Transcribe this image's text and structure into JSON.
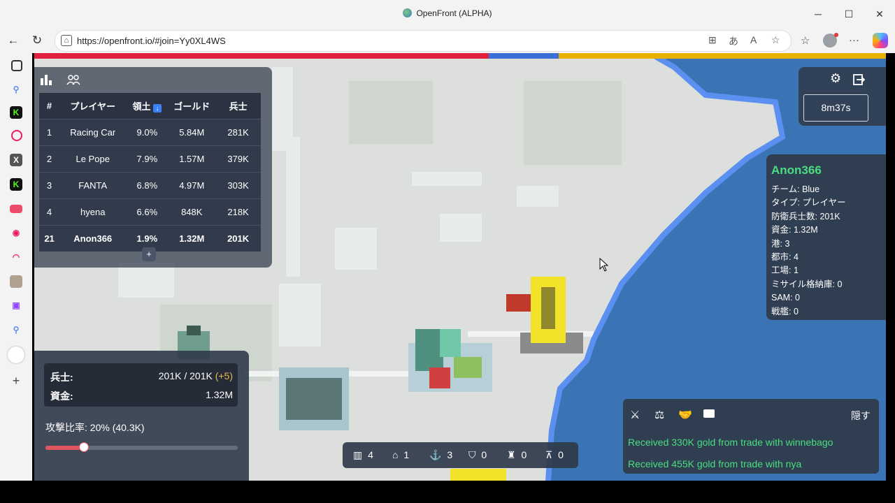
{
  "window": {
    "title": "OpenFront (ALPHA)",
    "minimize": "─",
    "maximize": "☐",
    "close": "✕"
  },
  "browser": {
    "url": "https://openfront.io/#join=Yy0XL4WS"
  },
  "colors": {
    "red_bar": "#e0203c",
    "blue_bar": "#3a6fd8",
    "yellow_bar": "#e8b000",
    "ocean": "#3a74b4",
    "shore": "#5b8ff0",
    "green_text": "#4ade80"
  },
  "leaderboard": {
    "headers": [
      "#",
      "プレイヤー",
      "領土",
      "ゴールド",
      "兵士"
    ],
    "sort_icon": "arrow-down-icon",
    "rows": [
      {
        "rank": "1",
        "name": "Racing Car",
        "territory": "9.0%",
        "gold": "5.84M",
        "troops": "281K"
      },
      {
        "rank": "2",
        "name": "Le Pope",
        "territory": "7.9%",
        "gold": "1.57M",
        "troops": "379K"
      },
      {
        "rank": "3",
        "name": "FANTA",
        "territory": "6.8%",
        "gold": "4.97M",
        "troops": "303K"
      },
      {
        "rank": "4",
        "name": "hyena",
        "territory": "6.6%",
        "gold": "848K",
        "troops": "218K"
      },
      {
        "rank": "21",
        "name": "Anon366",
        "territory": "1.9%",
        "gold": "1.32M",
        "troops": "201K"
      }
    ],
    "expand_label": "+"
  },
  "timer": {
    "value": "8m37s"
  },
  "player_info": {
    "name": "Anon366",
    "lines": [
      "チーム: Blue",
      "タイプ: プレイヤー",
      "防衛兵士数: 201K",
      "資金: 1.32M",
      "港: 3",
      "都市: 4",
      "工場: 1",
      "ミサイル格納庫: 0",
      "SAM: 0",
      "戦艦: 0"
    ]
  },
  "status": {
    "troops_label": "兵士:",
    "troops_value": "201K / 201K",
    "troops_delta": "(+5)",
    "gold_label": "資金:",
    "gold_value": "1.32M",
    "attack_ratio_label": "攻撃比率: 20% (40.3K)",
    "attack_ratio": 0.2
  },
  "units": [
    {
      "icon": "city-icon",
      "count": "4"
    },
    {
      "icon": "factory-icon",
      "count": "1"
    },
    {
      "icon": "port-icon",
      "count": "3"
    },
    {
      "icon": "defense-post-icon",
      "count": "0"
    },
    {
      "icon": "missile-silo-icon",
      "count": "0"
    },
    {
      "icon": "sam-launcher-icon",
      "count": "0"
    }
  ],
  "events": {
    "hide_label": "隠す",
    "messages": [
      "Received 330K gold from trade with winnebago",
      "Received 455K gold from trade with nya"
    ]
  }
}
